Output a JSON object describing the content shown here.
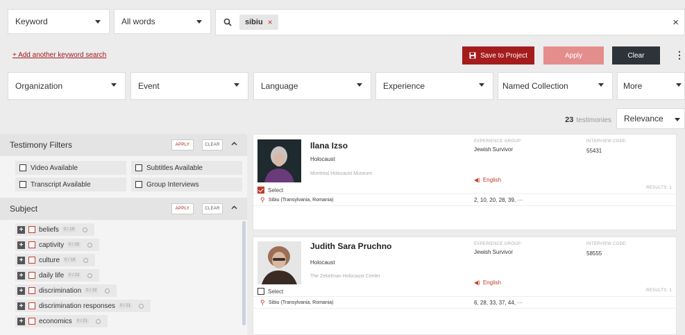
{
  "search": {
    "field_select": "Keyword",
    "match_select": "All words",
    "chip": "sibiu",
    "chip_remove": "×",
    "clear": "×"
  },
  "actions": {
    "add_keyword": "+ Add another keyword search",
    "save": "Save to Project",
    "apply": "Apply",
    "clear": "Clear",
    "more": "⋮"
  },
  "filters": {
    "organization": "Organization",
    "event": "Event",
    "language": "Language",
    "experience": "Experience",
    "named_collection": "Named Collection",
    "more": "More"
  },
  "results_bar": {
    "count": "23",
    "count_label": "testimonies",
    "sort": "Relevance"
  },
  "testimony_filters": {
    "title": "Testimony Filters",
    "apply": "APPLY",
    "clear": "CLEAR",
    "options": [
      "Video Available",
      "Subtitles Available",
      "Transcript Available",
      "Group Interviews"
    ]
  },
  "subject": {
    "title": "Subject",
    "apply": "APPLY",
    "clear": "CLEAR",
    "items": [
      {
        "label": "beliefs",
        "count": "0 / 19"
      },
      {
        "label": "captivity",
        "count": "0 / 20"
      },
      {
        "label": "culture",
        "count": "0 / 18"
      },
      {
        "label": "daily life",
        "count": "0 / 23"
      },
      {
        "label": "discrimination",
        "count": "0 / 19"
      },
      {
        "label": "discrimination responses",
        "count": "0 / 21"
      },
      {
        "label": "economics",
        "count": "0 / 21"
      }
    ]
  },
  "cards": [
    {
      "name": "Ilana Izso",
      "category": "Holocaust",
      "org": "Montreal Holocaust Museum",
      "select": "Select",
      "selected": true,
      "exp_label": "EXPERIENCE GROUP:",
      "exp_value": "Jewish Survivor",
      "code_label": "INTERVIEW CODE:",
      "code_value": "55431",
      "language": "English",
      "results": "RESULTS: 1",
      "location": "Sibiu (Transylvania, Romania)",
      "pages": "2, 10, 20, 28, 39, ···"
    },
    {
      "name": "Judith Sara Pruchno",
      "category": "Holocaust",
      "org": "The Zekelman Holocaust Center",
      "select": "Select",
      "selected": false,
      "exp_label": "EXPERIENCE GROUP:",
      "exp_value": "Jewish Survivor",
      "code_label": "INTERVIEW CODE:",
      "code_value": "58555",
      "language": "English",
      "results": "RESULTS: 1",
      "location": "Sibiu (Transylvania, Romania)",
      "pages": "6, 28, 33, 37, 44, ···"
    }
  ],
  "colors": {
    "brand_red": "#a51c1c",
    "apply_pink": "#e48d8d",
    "dark": "#2d3339"
  }
}
